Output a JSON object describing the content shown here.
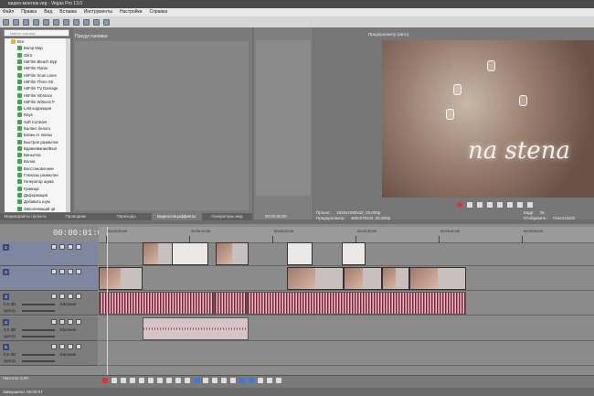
{
  "window": {
    "title": "видео-монтаж.veg - Vegas Pro 13.0"
  },
  "menu": [
    "Файл",
    "Правка",
    "Вид",
    "Вставка",
    "Инструменты",
    "Настройки",
    "Справка"
  ],
  "explorer": {
    "search_placeholder": "Найти плагины",
    "root": "Все",
    "items": [
      "Bump Map",
      "Glint",
      "HitFilm Bleach Byp",
      "HitFilm Flame",
      "HitFilm Scan Lines",
      "HitFilm Three Str",
      "HitFilm TV Damage",
      "HitFilm Vibrance",
      "HitFilm Witness P",
      "LAB-коррекция",
      "Rays",
      "Soft Contrast",
      "Баланс белого",
      "Блики от линзы",
      "Быстрое размытие",
      "Вдавливание/Вып",
      "Виньетка",
      "Волна",
      "Восстановление",
      "Глюкозы размытие",
      "Генератор шума",
      "Граница",
      "Деформация",
      "Добавить шум",
      "Заполняющий цв",
      "Звездообразован"
    ],
    "tabs": [
      "Медиафайлы проекта",
      "Проводник",
      "Переходы",
      "Видеоспецэффекты",
      "Генераторы мед"
    ],
    "active_tab": 3
  },
  "presets": {
    "title": "Предустановка:"
  },
  "mid": {
    "time": "00:00:00;00"
  },
  "preview": {
    "label": "Предпросмотр (авто)",
    "overlay_text": "na stena",
    "info_left": [
      "Проект:",
      "Предпросмотр:"
    ],
    "info_left_values": [
      "1920x1080x32; 25,000p",
      "480x270x32; 25,000p"
    ],
    "info_right": [
      "Кадр:",
      "Отобразить:"
    ],
    "info_right_values": [
      "35",
      "724x413x32"
    ]
  },
  "timeline": {
    "timecode": "00:00:01:01",
    "ruler": [
      "00:00:00;00",
      "00:00:10;00",
      "00:00:20;00",
      "00:00:30;00",
      "00:00:40;00",
      "00:00:50;00"
    ],
    "tracks": [
      {
        "num": "1",
        "type": "video"
      },
      {
        "num": "2",
        "type": "video"
      },
      {
        "num": "3",
        "type": "audio",
        "vol": "0,0 dB",
        "pan": "Центр",
        "label": "Касание"
      },
      {
        "num": "4",
        "type": "audio",
        "vol": "0,0 dB",
        "pan": "Центр",
        "label": "Касание"
      },
      {
        "num": "5",
        "type": "audio",
        "vol": "0,0 dB",
        "pan": "Центр",
        "label": "Касание"
      }
    ]
  },
  "bottom": {
    "rate_label": "Частота: 0,00"
  },
  "status": {
    "text": "Завершено: 00:00:07"
  }
}
